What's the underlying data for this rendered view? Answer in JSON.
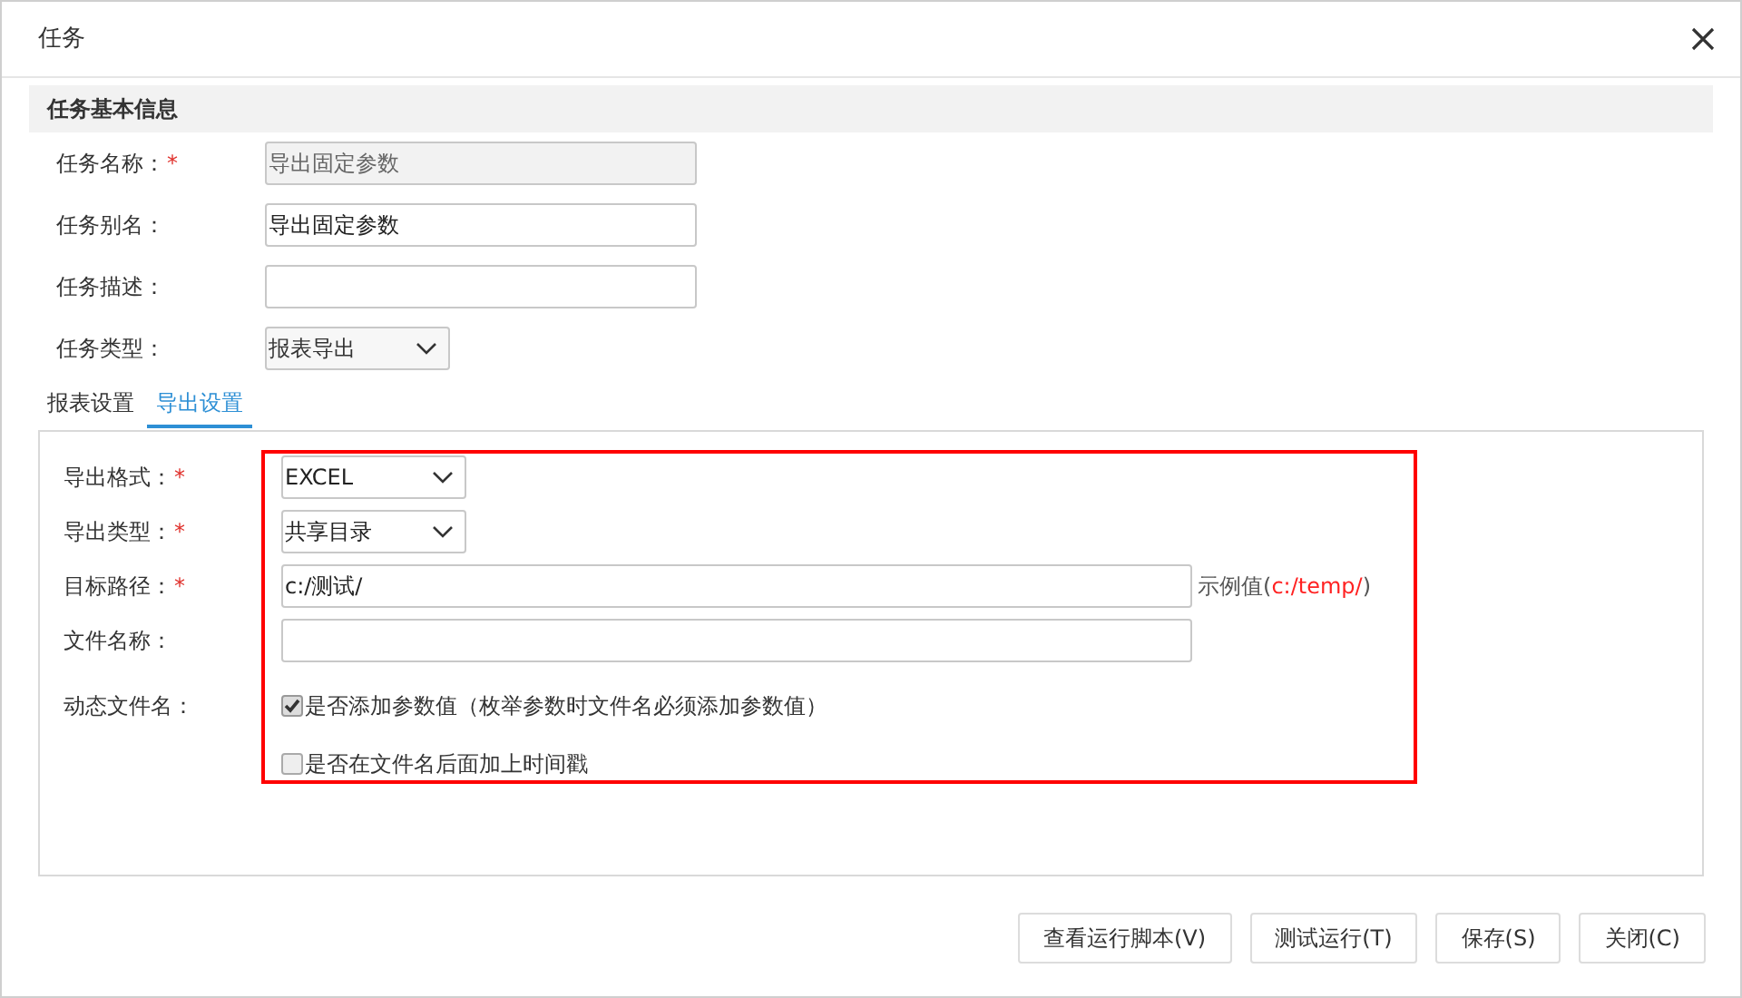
{
  "window": {
    "title": "任务"
  },
  "section": {
    "title": "任务基本信息"
  },
  "basic_fields": [
    {
      "label": "任务名称：",
      "required_mark": "*",
      "kind": "text",
      "value": "导出固定参数",
      "disabled": true
    },
    {
      "label": "任务别名：",
      "kind": "text",
      "value": "导出固定参数",
      "disabled": false
    },
    {
      "label": "任务描述：",
      "kind": "text",
      "disabled": false
    },
    {
      "label": "任务类型：",
      "kind": "select",
      "value": "报表导出"
    }
  ],
  "tabs": [
    {
      "label": "报表设置",
      "selected": false
    },
    {
      "label": "导出设置",
      "selected": true
    }
  ],
  "export_fields": [
    {
      "label": "导出格式：",
      "required_mark": "*",
      "kind": "select",
      "value": "EXCEL"
    },
    {
      "label": "导出类型：",
      "required_mark": "*",
      "kind": "select",
      "value": "共享目录"
    },
    {
      "label": "目标路径：",
      "required_mark": "*",
      "kind": "text",
      "value": "c:/测试/",
      "hint": {
        "prefix": "示例值(",
        "example": "c:/temp/",
        "suffix": ")"
      }
    },
    {
      "label": "文件名称：",
      "kind": "text"
    },
    {
      "label": "动态文件名：",
      "kind": "checks",
      "options": [
        {
          "label": "是否添加参数值（枚举参数时文件名必须添加参数值）",
          "checked": true
        },
        {
          "label": "是否在文件名后面加上时间戳",
          "checked": false
        }
      ]
    }
  ],
  "buttons": [
    "查看运行脚本(V)",
    "测试运行(T)",
    "保存(S)",
    "关闭(C)"
  ]
}
